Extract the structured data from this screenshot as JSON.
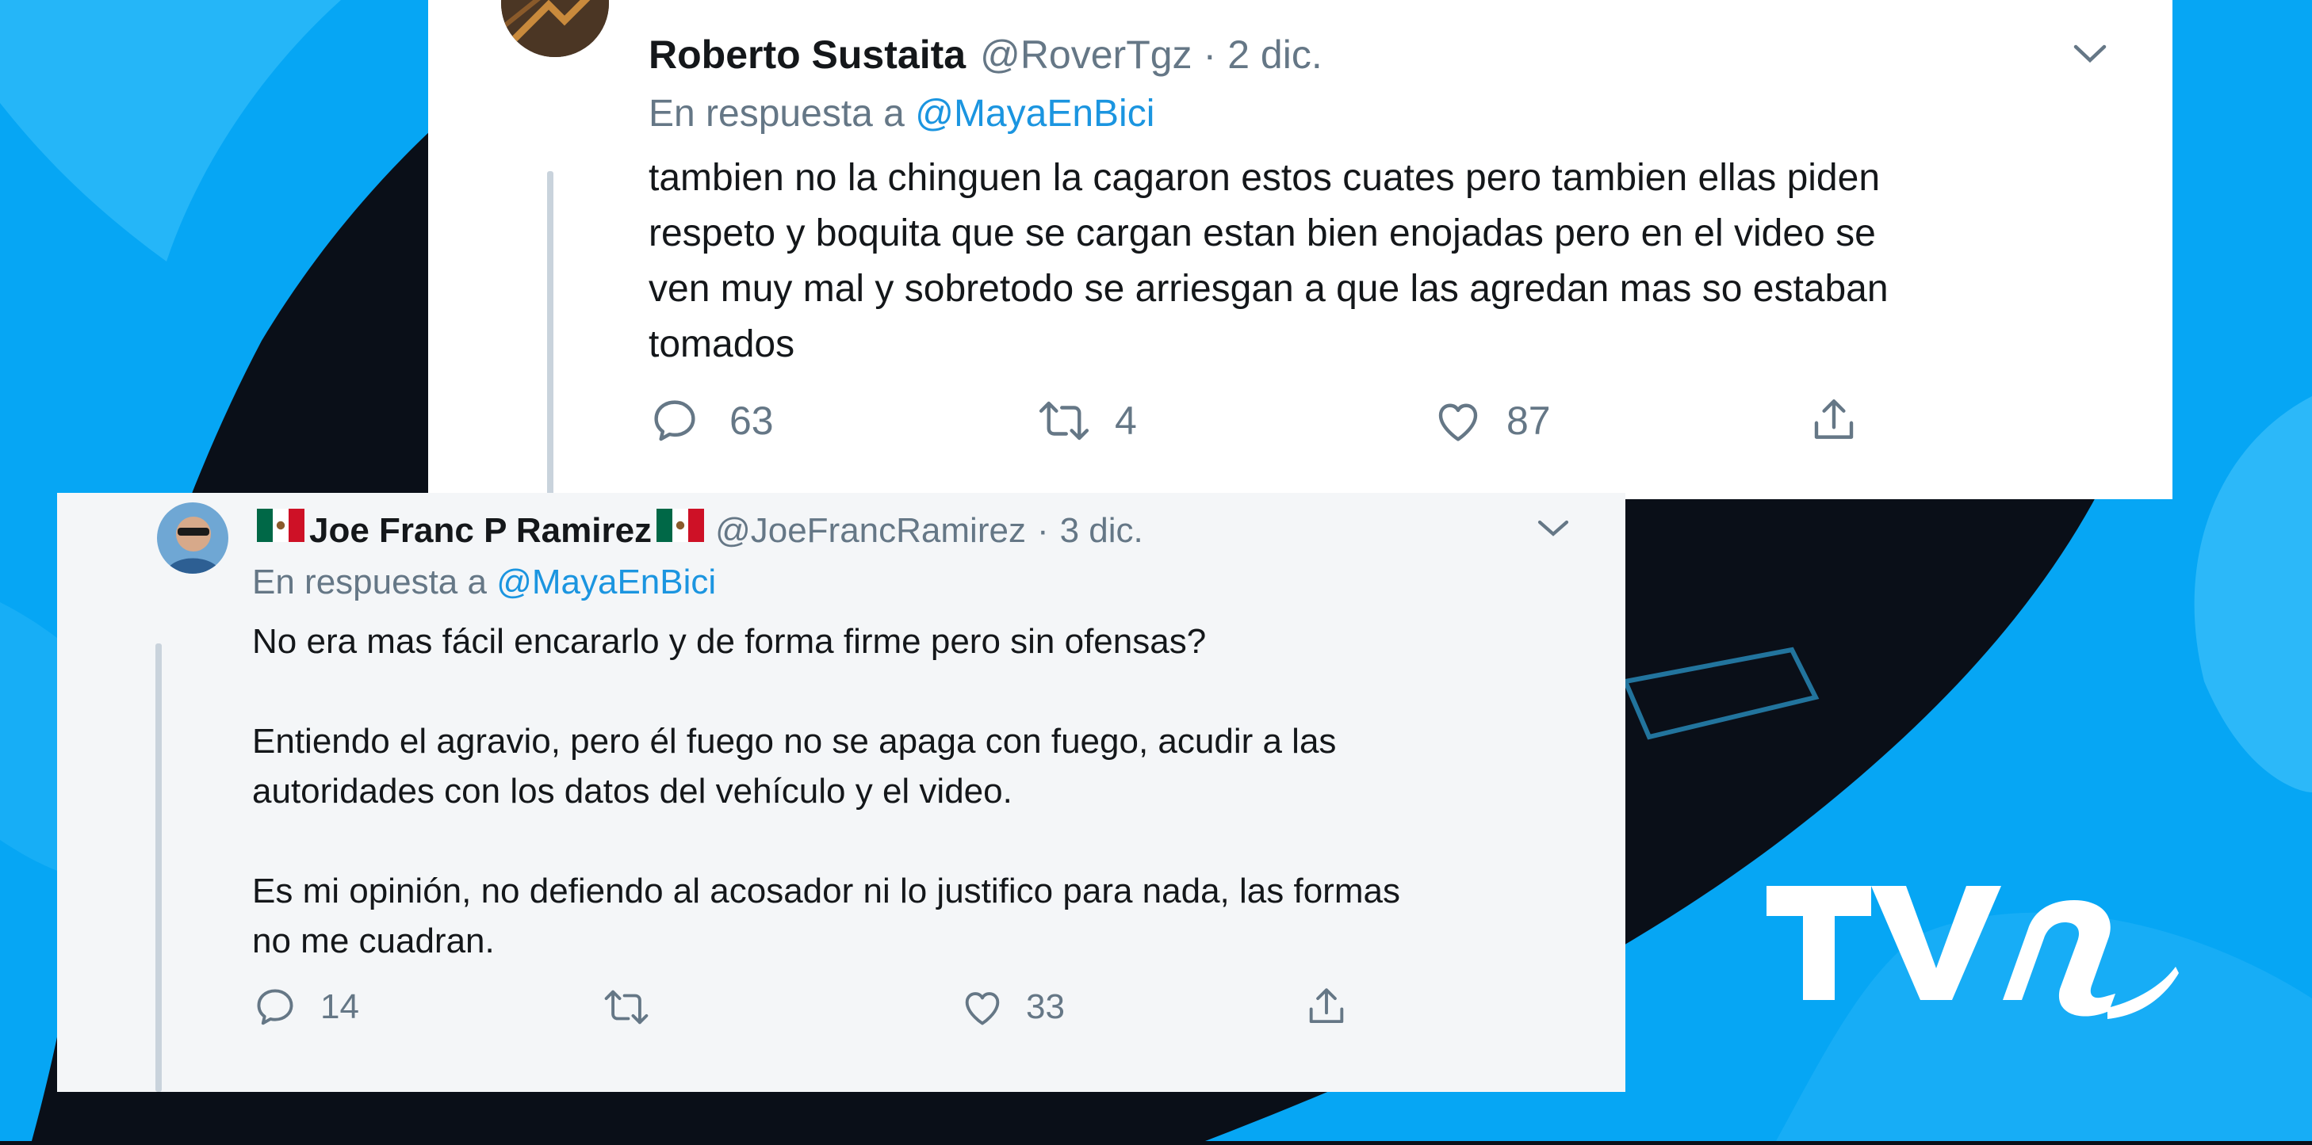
{
  "tweets": [
    {
      "author": "Roberto Sustaita",
      "handle": "@RoverTgz",
      "separator": "·",
      "date": "2 dic.",
      "reply_prefix": "En respuesta a ",
      "reply_mention": "@MayaEnBici",
      "text": "tambien no la chinguen la cagaron estos cuates pero tambien ellas piden\nrespeto y boquita que se cargan estan bien enojadas pero en el video se\nven muy mal y sobretodo se arriesgan a que las agredan mas so estaban\ntomados",
      "replies": "63",
      "retweets": "4",
      "likes": "87"
    },
    {
      "author": "Joe Franc P Ramirez",
      "handle": "@JoeFrancRamirez",
      "separator": "·",
      "date": "3 dic.",
      "reply_prefix": "En respuesta a ",
      "reply_mention": "@MayaEnBici",
      "text": "No era mas fácil encararlo y de forma firme pero sin ofensas?\n\nEntiendo el agravio, pero él fuego no se apaga con fuego, acudir a las\nautoridades con los datos del vehículo y el video.\n\nEs mi opinión, no defiendo al acosador ni lo justifico para nada, las formas\nno me cuadran.",
      "replies": "14",
      "retweets": "",
      "likes": "33"
    }
  ],
  "brand": {
    "logo_text": "TVn"
  },
  "icons": {
    "reply": "reply-bubble-icon",
    "retweet": "retweet-icon",
    "like": "heart-icon",
    "share": "share-icon",
    "more": "chevron-down-icon",
    "flag": "mexico-flag-icon"
  },
  "colors": {
    "background_blue": "#08a7f5",
    "mention_blue": "#1b95e0",
    "text": "#14171a",
    "secondary_text": "#657786"
  }
}
